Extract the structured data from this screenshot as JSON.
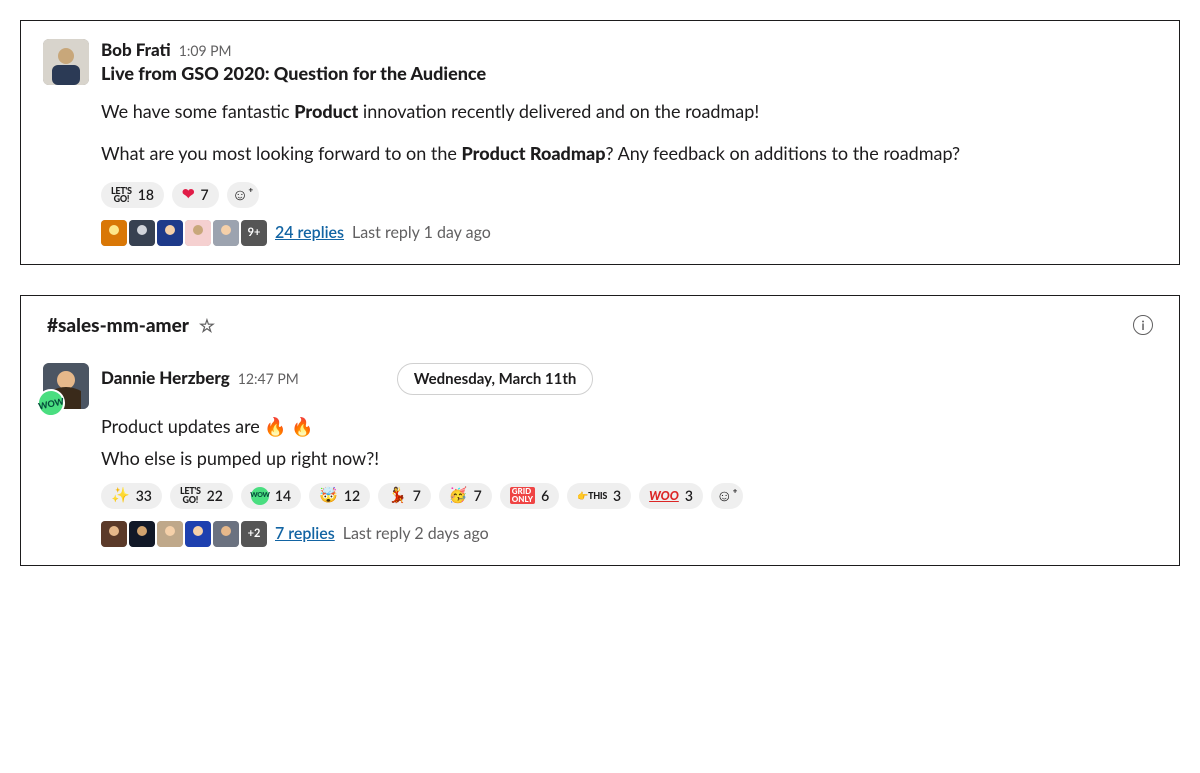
{
  "post1": {
    "author": "Bob Frati",
    "time": "1:09 PM",
    "subject": "Live from GSO 2020: Question for the Audience",
    "body_plain1a": "We have some fantastic ",
    "body_bold1": "Product",
    "body_plain1b": " innovation recently delivered and on the roadmap!",
    "body_plain2a": "What are you most looking forward to on the ",
    "body_bold2": "Product Roadmap",
    "body_plain2b": "? Any feedback on additions to the roadmap?",
    "reactions": {
      "letsgo": "18",
      "heart": "7"
    },
    "thread_more": "9+",
    "replies": "24 replies",
    "last_reply": "Last reply 1 day ago"
  },
  "channel": {
    "name": "#sales-mm-amer"
  },
  "post2": {
    "author": "Dannie Herzberg",
    "time": "12:47 PM",
    "date_pill": "Wednesday, March 11th",
    "status_badge": "WOW",
    "line1": "Product updates are ",
    "line2": "Who else is pumped up right now?!",
    "reactions": {
      "sparkle": "33",
      "letsgo": "22",
      "wow": "14",
      "face1": "12",
      "dance": "7",
      "face2": "7",
      "gridonly": "6",
      "this": "3",
      "woo": "3"
    },
    "thread_more": "+2",
    "replies": "7 replies",
    "last_reply": "Last reply 2 days ago"
  }
}
